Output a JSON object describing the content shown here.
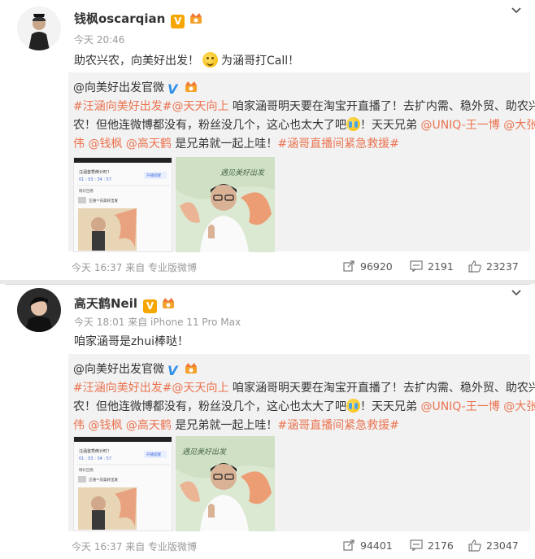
{
  "posts": [
    {
      "username": "钱枫oscarqian",
      "meta": "今天 20:46",
      "text_before_emoji": "助农兴农，向美好出发！",
      "text_after_emoji": "为涵哥打Call！",
      "repost": {
        "author": "@向美好出发官微",
        "line1_tag1": "#汪涵向美好出发#",
        "line1_tag2": "@天天向上",
        "line1_rest": " 咱家涵哥明天要在淘宝开直播了！去扩内需、稳外贸、助农兴",
        "line2_start": "农！但他连微博都没有，粉丝没几个，这心也太大了吧",
        "line2_mid": "！天天兄弟 ",
        "line2_mention1": "@UNIQ-王一博",
        "line2_mention2": " @大张",
        "line3_mention": "伟",
        "line3_mention2": " @钱枫",
        "line3_mention3": " @高天鹤",
        "line3_rest": " 是兄弟就一起上哇！",
        "line3_tag": "#涵哥直播间紧急救援#"
      },
      "footer": {
        "source": "今天 16:37 来自 专业版微博",
        "reposts": "96920",
        "comments": "2191",
        "likes": "23237"
      }
    },
    {
      "username": "高天鹤Neil",
      "meta": "今天 18:01 来自 iPhone 11 Pro Max",
      "text": "咱家涵哥是zhui棒哒！",
      "repost": {
        "author": "@向美好出发官微",
        "line1_tag1": "#汪涵向美好出发#",
        "line1_tag2": "@天天向上",
        "line1_rest": " 咱家涵哥明天要在淘宝开直播了！去扩内需、稳外贸、助农兴",
        "line2_start": "农！但他连微博都没有，粉丝没几个，这心也太大了吧",
        "line2_mid": "！天天兄弟 ",
        "line2_mention1": "@UNIQ-王一博",
        "line2_mention2": " @大张",
        "line3_mention": "伟",
        "line3_mention2": " @钱枫",
        "line3_mention3": " @高天鹤",
        "line3_rest": " 是兄弟就一起上哇！",
        "line3_tag": "#涵哥直播间紧急救援#"
      },
      "footer": {
        "source": "今天 16:37 来自 专业版微博",
        "reposts": "94401",
        "comments": "2176",
        "likes": "23047"
      }
    }
  ],
  "thumbnail": {
    "page_title": "汪涵首秀倒计时！",
    "countdown": "01 : 03 : 34 : 57",
    "button": "开播提醒",
    "shop": "精彩回看",
    "item": "汪涵＝向美好出发",
    "poster_caption": "遇见美好出发"
  },
  "colors": {
    "link": "#eb7350",
    "verified_orange": "#f6a600",
    "verified_blue": "#2f8fe8",
    "repost_bg": "#f2f2f2"
  },
  "icons": {
    "expand": "chevron-down-icon",
    "repost": "share-icon",
    "comment": "comment-icon",
    "like": "thumbs-up-icon"
  }
}
